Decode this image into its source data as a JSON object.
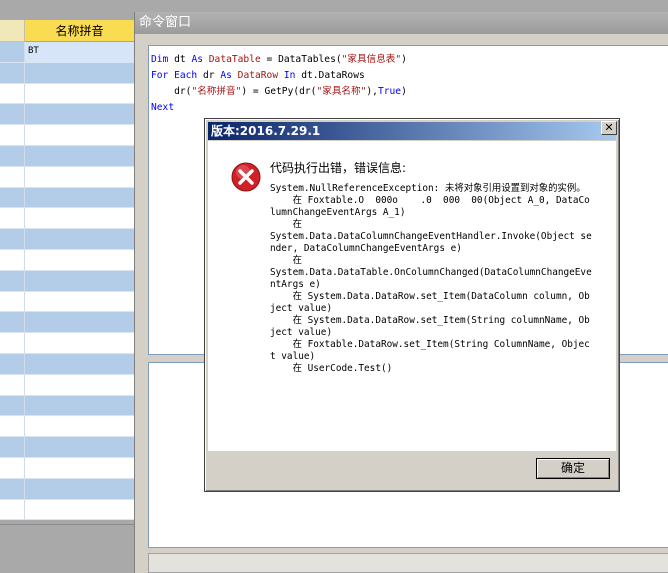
{
  "grid": {
    "column_header": "名称拼音",
    "rows": [
      "BT",
      "",
      "",
      "",
      "",
      "",
      "",
      "",
      "",
      "",
      "",
      "",
      "",
      "",
      "",
      "",
      "",
      "",
      "",
      "",
      "",
      "",
      ""
    ]
  },
  "command_window": {
    "title": "命令窗口",
    "code": {
      "line1": {
        "kw": "Dim",
        "v": " dt ",
        "kw2": "As",
        "sp": " ",
        "ty": "DataTable",
        "eq": " = DataTables(",
        "str": "\"家具信息表\"",
        "end": ")"
      },
      "line2": {
        "kw": "For Each",
        "v": " dr ",
        "kw2": "As",
        "sp": " ",
        "ty": "DataRow",
        "sp2": " ",
        "kw3": "In",
        "end": " dt.DataRows"
      },
      "line3": {
        "pre": "    dr(",
        "str": "\"名称拼音\"",
        "mid": ") = GetPy(dr(",
        "str2": "\"家具名称\"",
        "mid2": "),",
        "kw": "True",
        "end": ")"
      },
      "line4": {
        "kw": "Next"
      }
    }
  },
  "dialog": {
    "title": "版本:2016.7.29.1",
    "close_glyph": "✕",
    "headline": "代码执行出错，错误信息:",
    "detail": "System.NullReferenceException: 未将对象引用设置到对象的实例。\n    在 Foxtable.O  000o    .0  000  00(Object A_0, DataColumnChangeEventArgs A_1)\n    在\nSystem.Data.DataColumnChangeEventHandler.Invoke(Object sender, DataColumnChangeEventArgs e)\n    在\nSystem.Data.DataTable.OnColumnChanged(DataColumnChangeEventArgs e)\n    在 System.Data.DataRow.set_Item(DataColumn column, Object value)\n    在 System.Data.DataRow.set_Item(String columnName, Object value)\n    在 Foxtable.DataRow.set_Item(String ColumnName, Object value)\n    在 UserCode.Test()",
    "ok_label": "确定"
  },
  "colors": {
    "grid_odd": "#b3cde9",
    "header_yellow": "#f9dc52",
    "dialog_title_start": "#0a246a",
    "dialog_title_end": "#a6caf0",
    "error_icon": "#d0202a"
  }
}
